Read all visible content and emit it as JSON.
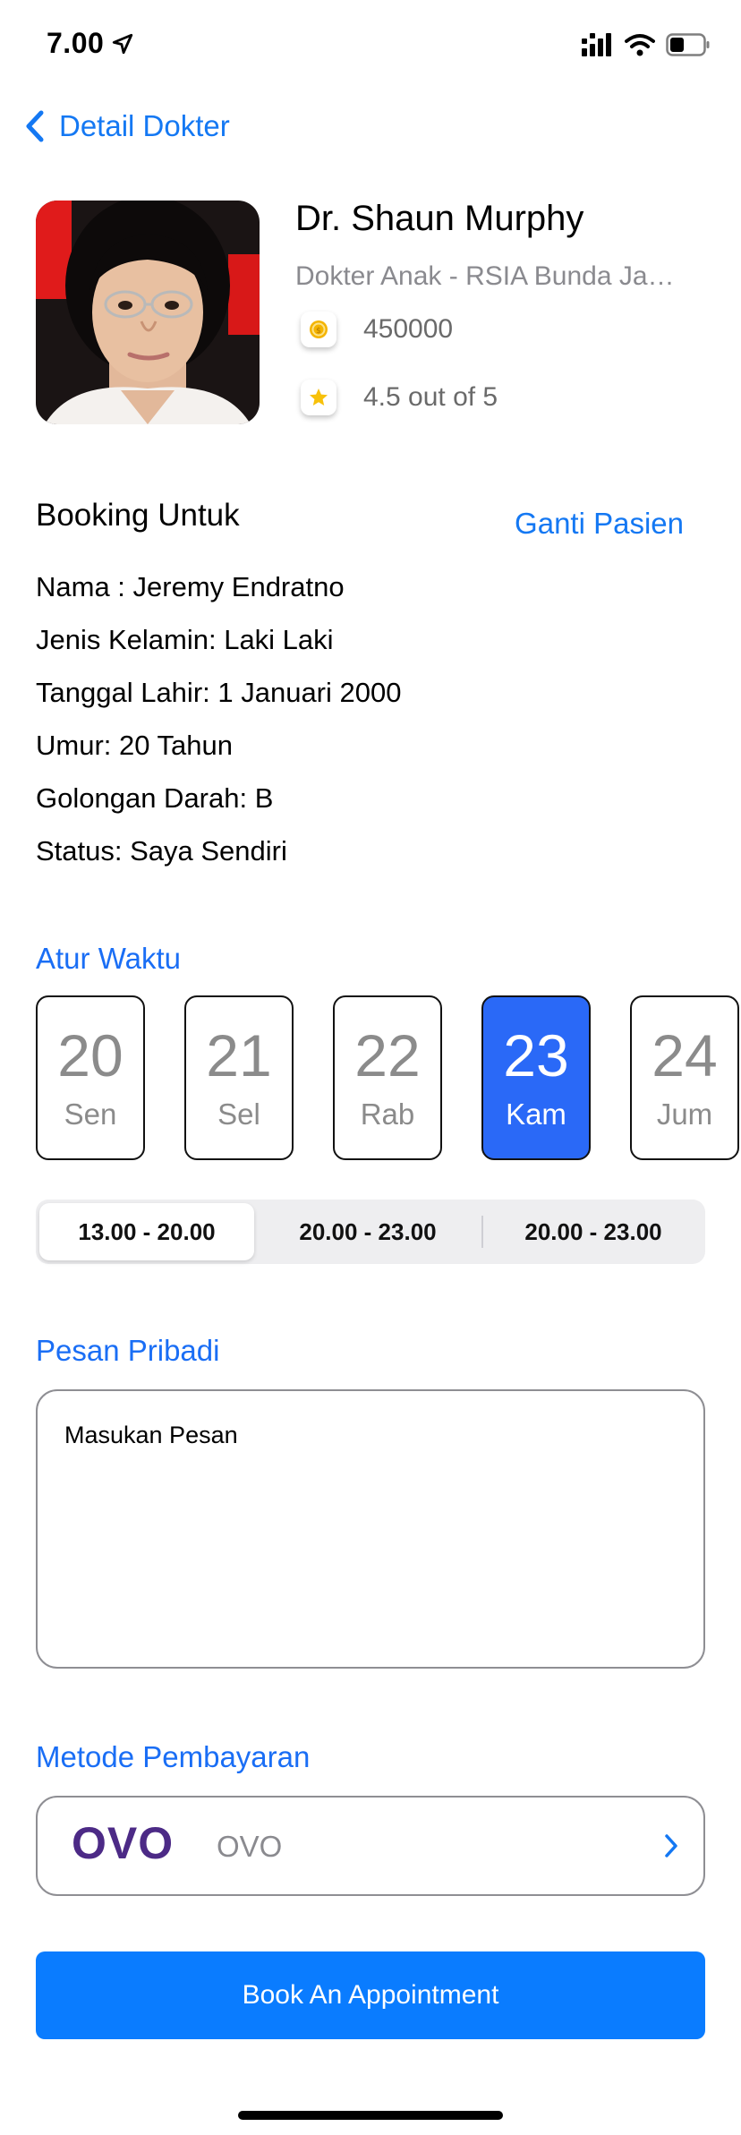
{
  "status_bar": {
    "time": "7.00"
  },
  "nav": {
    "back_label": "Detail Dokter"
  },
  "doctor": {
    "name": "Dr. Shaun Murphy",
    "specialty": "Dokter Anak - RSIA Bunda Jakarta",
    "price": "450000",
    "rating": "4.5 out of 5",
    "price_icon": "coin-icon",
    "rating_icon": "star-icon"
  },
  "booking": {
    "title": "Booking Untuk",
    "change_patient": "Ganti Pasien",
    "patient": [
      "Nama : Jeremy Endratno",
      "Jenis Kelamin: Laki Laki",
      "Tanggal Lahir: 1 Januari 2000",
      "Umur: 20 Tahun",
      "Golongan Darah: B",
      "Status: Saya Sendiri"
    ]
  },
  "schedule": {
    "title": "Atur Waktu",
    "dates": [
      {
        "num": "20",
        "day": "Sen",
        "selected": false
      },
      {
        "num": "21",
        "day": "Sel",
        "selected": false
      },
      {
        "num": "22",
        "day": "Rab",
        "selected": false
      },
      {
        "num": "23",
        "day": "Kam",
        "selected": true
      },
      {
        "num": "24",
        "day": "Jum",
        "selected": false
      }
    ],
    "times": [
      "13.00 - 20.00",
      "20.00 - 23.00",
      "20.00 - 23.00"
    ],
    "selected_time_index": 0
  },
  "message": {
    "title": "Pesan Pribadi",
    "placeholder": "Masukan Pesan"
  },
  "payment": {
    "title": "Metode Pembayaran",
    "logo_text": "OVO",
    "method": "OVO"
  },
  "actions": {
    "book_label": "Book An Appointment"
  },
  "colors": {
    "accent_blue": "#1478f3",
    "selected_date": "#2a69f7",
    "button_blue": "#0a7cff",
    "ovo_purple": "#4c2a86"
  }
}
